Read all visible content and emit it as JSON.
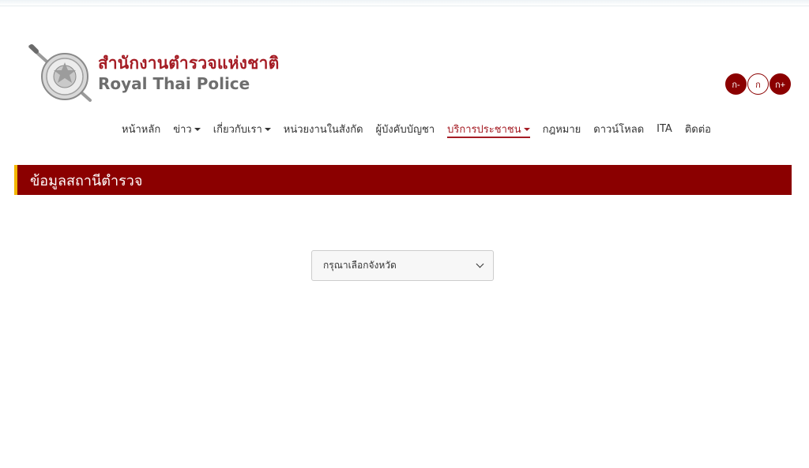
{
  "header": {
    "logo_icon": "royal-thai-police-emblem-icon",
    "title_th": "สำนักงานตำรวจแห่งชาติ",
    "title_en": "Royal Thai Police"
  },
  "font_controls": [
    {
      "label": "ก-",
      "style": "filled"
    },
    {
      "label": "ก",
      "style": "outline"
    },
    {
      "label": "ก+",
      "style": "filled"
    }
  ],
  "nav": {
    "items": [
      {
        "label": "หน้าหลัก",
        "dropdown": false,
        "active": false
      },
      {
        "label": "ข่าว",
        "dropdown": true,
        "active": false
      },
      {
        "label": "เกี่ยวกับเรา",
        "dropdown": true,
        "active": false
      },
      {
        "label": "หน่วยงานในสังกัด",
        "dropdown": false,
        "active": false
      },
      {
        "label": "ผู้บังคับบัญชา",
        "dropdown": false,
        "active": false
      },
      {
        "label": "บริการประชาชน",
        "dropdown": true,
        "active": true
      },
      {
        "label": "กฎหมาย",
        "dropdown": false,
        "active": false
      },
      {
        "label": "ดาวน์โหลด",
        "dropdown": false,
        "active": false
      },
      {
        "label": "ITA",
        "dropdown": false,
        "active": false
      },
      {
        "label": "ติดต่อ",
        "dropdown": false,
        "active": false
      }
    ]
  },
  "section": {
    "title": "ข้อมูลสถานีตำรวจ"
  },
  "province_select": {
    "selected": "กรุณาเลือกจังหวัด",
    "icon": "chevron-down-icon"
  },
  "colors": {
    "brand_red": "#8b0000",
    "title_red": "#a51c24",
    "accent_gold": "#f2b700"
  }
}
